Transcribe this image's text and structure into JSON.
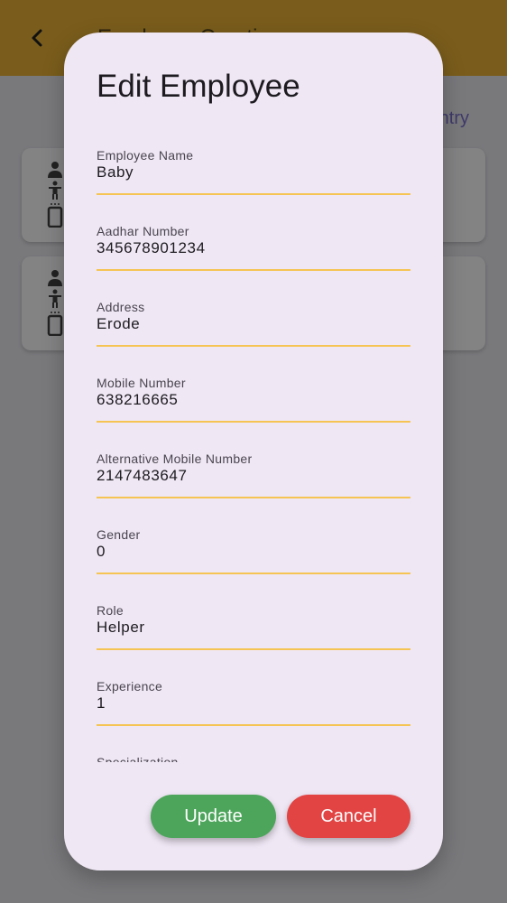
{
  "appbar": {
    "title": "Employee Creation",
    "back_icon": "arrow-back-icon"
  },
  "background": {
    "link_text": "Entry"
  },
  "dialog": {
    "title": "Edit Employee",
    "fields": [
      {
        "label": "Employee Name",
        "value": "Baby"
      },
      {
        "label": "Aadhar Number",
        "value": "345678901234"
      },
      {
        "label": "Address",
        "value": "Erode"
      },
      {
        "label": "Mobile Number",
        "value": "638216665"
      },
      {
        "label": "Alternative Mobile Number",
        "value": "2147483647"
      },
      {
        "label": "Gender",
        "value": "0"
      },
      {
        "label": "Role",
        "value": "Helper"
      },
      {
        "label": "Experience",
        "value": "1"
      },
      {
        "label": "Specialization",
        "value": ""
      }
    ],
    "update_label": "Update",
    "cancel_label": "Cancel"
  },
  "colors": {
    "appbar": "#7a5d1c",
    "dialog_bg": "#efe7f4",
    "underline": "#f5c453",
    "update_button": "#4ca55a",
    "cancel_button": "#e24343"
  }
}
